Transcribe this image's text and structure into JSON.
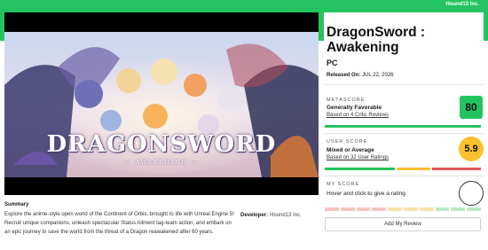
{
  "topbar": {
    "brand": "Hound13 Inc."
  },
  "hero": {
    "logo_main": "DRAGONSWORD",
    "logo_sub": "— AWAKENING —"
  },
  "summary": {
    "heading": "Summary",
    "text": "Explore the anime-style open world of the Continent of Orbis, brought to life with Unreal Engine 5! Recruit unique companions, unleash spectacular Status Ailment tag-team action, and embark on an epic journey to save the world from the threat of a Dragon reawakened after 60 years."
  },
  "developer": {
    "label": "Developer:",
    "value": "Hound13 Inc."
  },
  "game": {
    "title": "DragonSword : Awakening",
    "platform": "PC",
    "released_label": "Released On:",
    "released_date": "JUL 22, 2026"
  },
  "metascore": {
    "label": "METASCORE",
    "verdict": "Generally Favorable",
    "link": "Based on 4 Critic Reviews",
    "score": "80",
    "color": "#23c45f",
    "distribution": {
      "positive": 4,
      "mixed": 0,
      "negative": 0
    }
  },
  "userscore": {
    "label": "USER SCORE",
    "verdict": "Mixed or Average",
    "link": "Based on 32 User Ratings",
    "score": "5.9",
    "color": "#fbc02d",
    "distribution": {
      "positive": 0.46,
      "mixed": 0.22,
      "negative": 0.32
    }
  },
  "myscore": {
    "label": "MY SCORE",
    "prompt": "Hover and click to give a rating",
    "add_review": "Add My Review"
  },
  "colors": {
    "positive": "#23c45f",
    "mixed": "#fbc02d",
    "negative": "#e25555"
  }
}
